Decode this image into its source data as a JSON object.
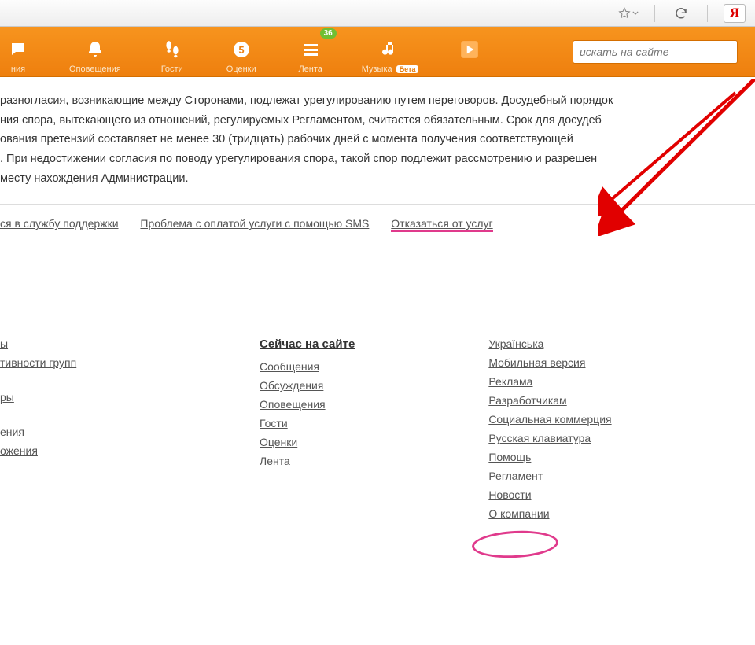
{
  "browser": {
    "yandex_letter": "Я"
  },
  "topnav": {
    "items": [
      {
        "label": "ния"
      },
      {
        "label": "Оповещения"
      },
      {
        "label": "Гости"
      },
      {
        "label": "Оценки"
      },
      {
        "label": "Лента",
        "badge": "36"
      },
      {
        "label": "Музыка",
        "mini": "Бета"
      }
    ],
    "search_placeholder": "искать на сайте"
  },
  "body_text": "разногласия, возникающие между Сторонами, подлежат урегулированию путем переговоров. Досудебный порядок\nния спора, вытекающего из отношений, регулируемых Регламентом, считается обязательным. Срок для досудеб\nования претензий составляет не менее 30 (тридцать) рабочих дней с момента получения соответствующей\n. При недостижении согласия по поводу урегулирования спора, такой спор подлежит рассмотрению и разрешен\nместу нахождения Администрации.",
  "link_row": {
    "support": "ся в службу поддержки",
    "payment": "Проблема с оплатой услуги с помощью SMS",
    "refuse": "Отказаться от услуг"
  },
  "footer": {
    "left": {
      "group1": [
        "ы",
        "тивности групп"
      ],
      "group2": [
        "ры"
      ],
      "group3": [
        "ения",
        "ожения"
      ]
    },
    "middle": {
      "heading": "Сейчас на сайте",
      "links": [
        "Сообщения",
        "Обсуждения",
        "Оповещения",
        "Гости",
        "Оценки",
        "Лента"
      ]
    },
    "right": {
      "links": [
        "Українська",
        "Мобильная версия",
        "Реклама",
        "Разработчикам",
        "Социальная коммерция",
        "Русская клавиатура",
        "Помощь",
        "Регламент",
        "Новости",
        "О компании"
      ]
    }
  }
}
